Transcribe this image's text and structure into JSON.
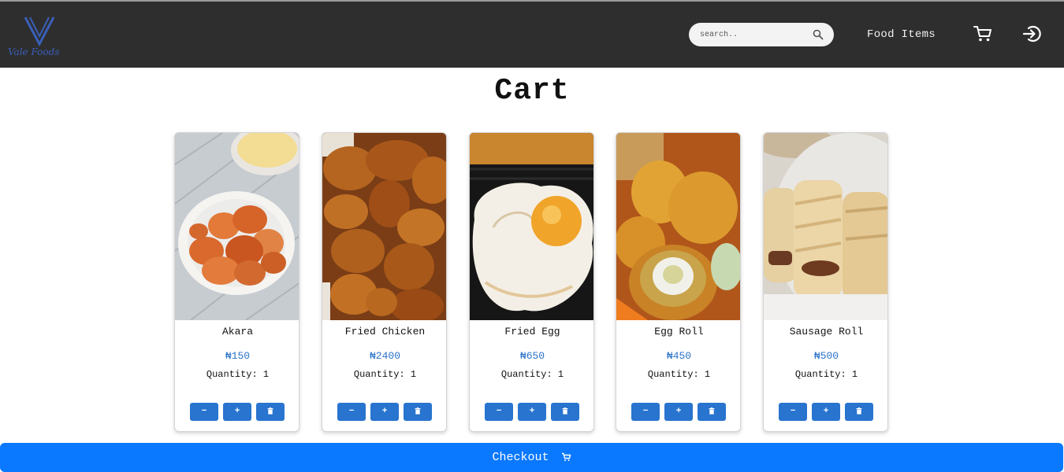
{
  "brand": {
    "logo_text": "Vale Foods"
  },
  "header": {
    "search": {
      "placeholder": "search..",
      "value": ""
    },
    "nav_link": "Food Items",
    "icons": [
      "search-icon",
      "cart-icon",
      "login-icon"
    ]
  },
  "page": {
    "title": "Cart"
  },
  "cart_items": [
    {
      "name": "Akara",
      "price": "₦150",
      "quantity_label": "Quantity:",
      "quantity": "1"
    },
    {
      "name": "Fried Chicken",
      "price": "₦2400",
      "quantity_label": "Quantity:",
      "quantity": "1"
    },
    {
      "name": "Fried Egg",
      "price": "₦650",
      "quantity_label": "Quantity:",
      "quantity": "1"
    },
    {
      "name": "Egg Roll",
      "price": "₦450",
      "quantity_label": "Quantity:",
      "quantity": "1"
    },
    {
      "name": "Sausage Roll",
      "price": "₦500",
      "quantity_label": "Quantity:",
      "quantity": "1"
    }
  ],
  "buttons": {
    "decrease": "−",
    "increase": "+",
    "delete_icon": "trash-icon"
  },
  "checkout": {
    "label": "Checkout",
    "icon": "cart-icon"
  },
  "colors": {
    "navbar": "#2e2e2e",
    "accent_button": "#2874cf",
    "checkout_bar": "#0a78ff",
    "price_text": "#2a72c8",
    "logo": "#3a5fb8"
  }
}
